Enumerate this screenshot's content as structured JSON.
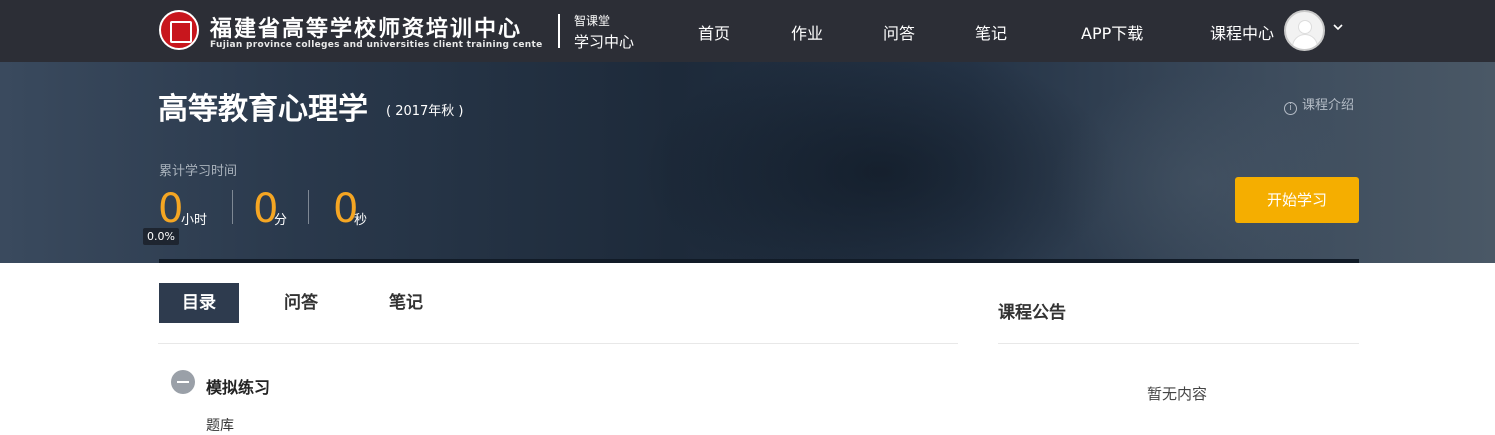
{
  "header": {
    "brand_cn": "福建省高等学校师资培训中心",
    "brand_en": "Fujian province colleges and universities client training cente",
    "sub_top": "智课堂",
    "sub_bottom": "学习中心",
    "nav": [
      "首页",
      "作业",
      "问答",
      "笔记",
      "APP下载"
    ],
    "course_center": "课程中心",
    "icons": [
      "logo-seal",
      "avatar",
      "chevron-down-icon"
    ]
  },
  "banner": {
    "course_title": "高等教育心理学",
    "course_term": "( 2017年秋 )",
    "intro_link": "课程介绍",
    "time_label": "累计学习时间",
    "hours": "0",
    "hours_unit": "小时",
    "minutes": "0",
    "minutes_unit": "分",
    "seconds": "0",
    "seconds_unit": "秒",
    "progress_text": "0.0%",
    "progress_fraction": 0.0,
    "start_button": "开始学习"
  },
  "tabs": [
    "目录",
    "问答",
    "笔记"
  ],
  "catalog": {
    "section_title": "模拟练习",
    "items": [
      "题库"
    ]
  },
  "notice": {
    "title": "课程公告",
    "empty": "暂无内容"
  },
  "colors": {
    "topbar": "#2c2e36",
    "accent": "#f5a623",
    "button": "#f5ae00",
    "tab_active": "#2e3b4e"
  }
}
